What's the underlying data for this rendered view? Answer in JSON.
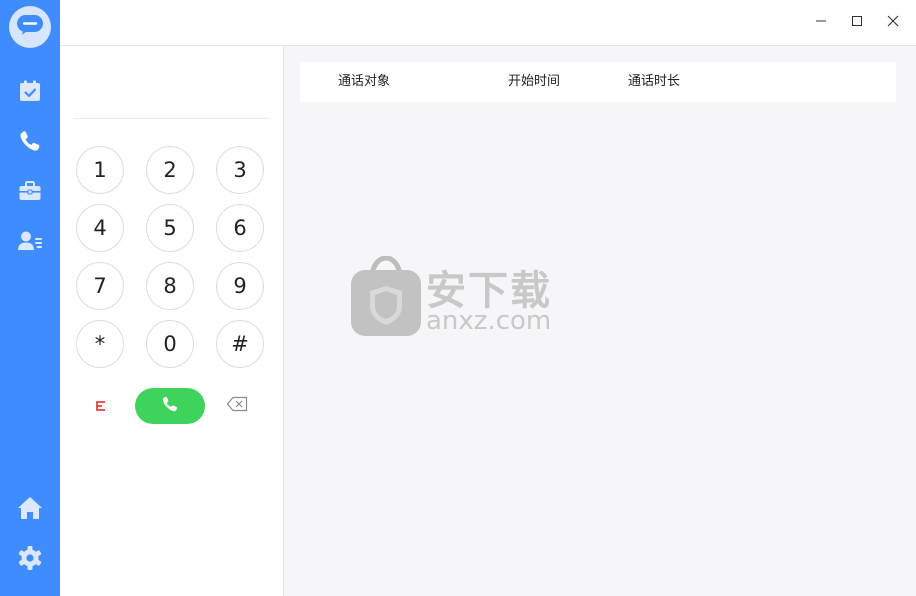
{
  "sidebar": {
    "logo_icon": "chat-bubble-icon",
    "items": [
      {
        "name": "calendar-check-icon"
      },
      {
        "name": "phone-icon"
      },
      {
        "name": "briefcase-icon"
      },
      {
        "name": "contacts-icon"
      }
    ],
    "bottom": [
      {
        "name": "home-icon"
      },
      {
        "name": "gear-icon"
      }
    ]
  },
  "window": {
    "minimize": "minimize-icon",
    "maximize": "maximize-icon",
    "close": "close-icon"
  },
  "dialer": {
    "display_value": "",
    "keys": [
      "1",
      "2",
      "3",
      "4",
      "5",
      "6",
      "7",
      "8",
      "9",
      "*",
      "0",
      "#"
    ],
    "call_color": "#3ed35a"
  },
  "table": {
    "headers": [
      "通话对象",
      "开始时间",
      "通话时长"
    ]
  },
  "watermark": {
    "title": "安下载",
    "domain": "anxz.com"
  },
  "colors": {
    "sidebar": "#3f8cff",
    "content_bg": "#f6f5f8"
  }
}
